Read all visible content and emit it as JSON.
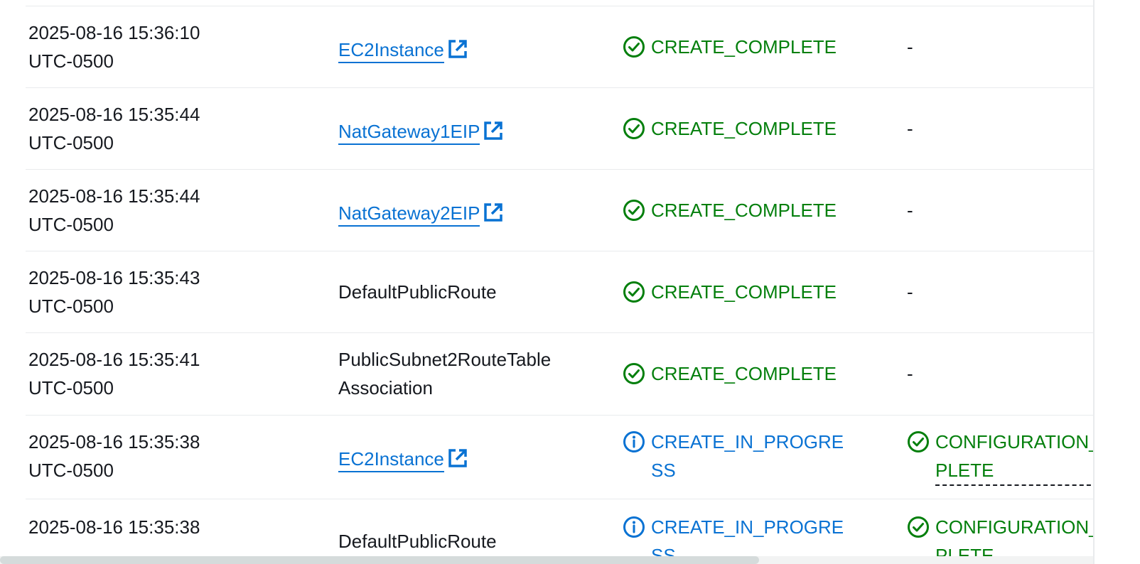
{
  "rows": [
    {
      "time_line1": "2025-08-16 15:36:10",
      "time_line2": "UTC-0500",
      "logical_id": "EC2Instance",
      "logical_id_is_link": true,
      "status": "CREATE_COMPLETE",
      "status_kind": "complete",
      "reason": "-"
    },
    {
      "time_line1": "2025-08-16 15:35:44",
      "time_line2": "UTC-0500",
      "logical_id": "NatGateway1EIP",
      "logical_id_is_link": true,
      "status": "CREATE_COMPLETE",
      "status_kind": "complete",
      "reason": "-"
    },
    {
      "time_line1": "2025-08-16 15:35:44",
      "time_line2": "UTC-0500",
      "logical_id": "NatGateway2EIP",
      "logical_id_is_link": true,
      "status": "CREATE_COMPLETE",
      "status_kind": "complete",
      "reason": "-"
    },
    {
      "time_line1": "2025-08-16 15:35:43",
      "time_line2": "UTC-0500",
      "logical_id": "DefaultPublicRoute",
      "logical_id_is_link": false,
      "status": "CREATE_COMPLETE",
      "status_kind": "complete",
      "reason": "-"
    },
    {
      "time_line1": "2025-08-16 15:35:41",
      "time_line2": "UTC-0500",
      "logical_id": "PublicSubnet2RouteTableAssociation",
      "logical_id_is_link": false,
      "status": "CREATE_COMPLETE",
      "status_kind": "complete",
      "reason": "-"
    },
    {
      "time_line1": "2025-08-16 15:35:38",
      "time_line2": "UTC-0500",
      "logical_id": "EC2Instance",
      "logical_id_is_link": true,
      "status": "CREATE_IN_PROGRESS",
      "status_kind": "in-progress",
      "reason": "CONFIGURATION_COMPLETE"
    },
    {
      "time_line1": "2025-08-16 15:35:38",
      "time_line2": "",
      "logical_id": "DefaultPublicRoute",
      "logical_id_is_link": false,
      "status": "CREATE_IN_PROGRESS",
      "status_kind": "in-progress",
      "reason": "CONFIGURATION_COMPLETE"
    }
  ],
  "colors": {
    "complete": "#037f0c",
    "in_progress": "#0972d3",
    "link": "#0972d3",
    "divider": "#e9ebed"
  },
  "icons": {
    "complete": "check-circle-icon",
    "in_progress": "info-circle-icon",
    "link": "external-link-icon"
  }
}
